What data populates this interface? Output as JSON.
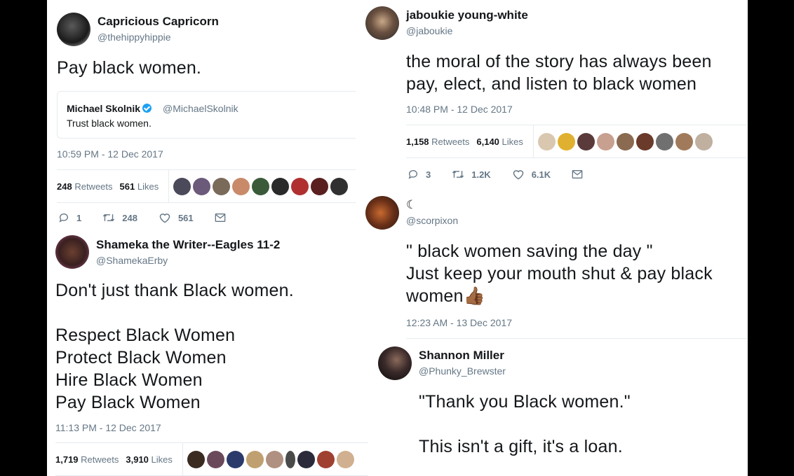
{
  "tweets": {
    "t1": {
      "name": "Capricious Capricorn",
      "handle": "@thehippyhippie",
      "text": "Pay black women.",
      "quote": {
        "name": "Michael Skolnik",
        "handle": "@MichaelSkolnik",
        "text": "Trust black women."
      },
      "time": "10:59 PM - 12 Dec 2017",
      "retweets_count": "248",
      "retweets_label": "Retweets",
      "likes_count": "561",
      "likes_label": "Likes",
      "actions": {
        "reply": "1",
        "retweet": "248",
        "like": "561"
      },
      "likers": [
        "#4a4a5a",
        "#6b5a7a",
        "#7a6a5a",
        "#c98a6a",
        "#3a5a3a",
        "#2a2a2a",
        "#b03030",
        "#5a2020",
        "#303030"
      ]
    },
    "t2": {
      "name": "jaboukie young-white",
      "handle": "@jaboukie",
      "text": "the moral of the story has always been\npay, elect, and listen to black women",
      "time": "10:48 PM - 12 Dec 2017",
      "retweets_count": "1,158",
      "retweets_label": "Retweets",
      "likes_count": "6,140",
      "likes_label": "Likes",
      "actions": {
        "reply": "3",
        "retweet": "1.2K",
        "like": "6.1K"
      },
      "likers": [
        "#d9c7b0",
        "#e0b030",
        "#5a3a3a",
        "#c8a090",
        "#8a6a50",
        "#6a3a2a",
        "#707070",
        "#a07a5a",
        "#c0b0a0"
      ]
    },
    "t3": {
      "name": "Shameka the Writer--Eagles 11-2",
      "handle": "@ShamekaErby",
      "text": "Don't just thank Black women.\n\nRespect Black Women\nProtect Black Women\nHire Black Women\nPay Black Women",
      "time": "11:13 PM - 12 Dec 2017",
      "retweets_count": "1,719",
      "retweets_label": "Retweets",
      "likes_count": "3,910",
      "likes_label": "Likes",
      "likers": [
        "#3a2a20",
        "#6a4a5a",
        "#2a3a6a",
        "#c0a070",
        "#b09080",
        "#4a4a4a",
        "#2a2a3a",
        "#a04030",
        "#d0b090"
      ]
    },
    "t4": {
      "name": "☾",
      "handle": "@scorpixon",
      "text": "\" black women saving the day \"\nJust keep your mouth shut & pay black\nwomen",
      "emoji": "👍🏾",
      "time": "12:23 AM - 13 Dec 2017"
    },
    "t5": {
      "name": "Shannon Miller",
      "handle": "@Phunky_Brewster",
      "text": "\"Thank you Black women.\"\n\nThis isn't a gift, it's a loan."
    }
  },
  "colors": {
    "text": "#14171a",
    "muted": "#657786",
    "border": "#e6ecf0",
    "verified": "#1da1f2"
  }
}
